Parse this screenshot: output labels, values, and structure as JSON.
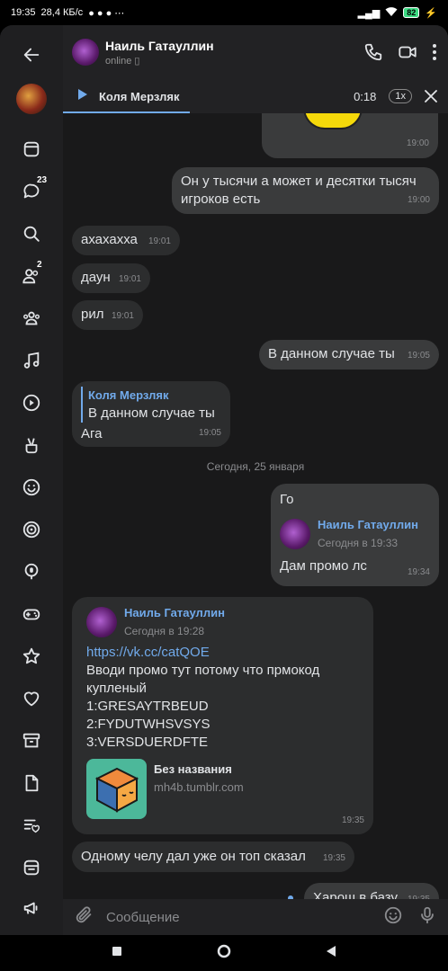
{
  "status_bar": {
    "time": "19:35",
    "speed": "28,4 КБ/с",
    "battery": "82"
  },
  "sidebar": {
    "badges": {
      "messages": "23",
      "friends": "2"
    }
  },
  "header": {
    "name": "Наиль Гатауллин",
    "status": "online"
  },
  "player": {
    "track_name": "Коля Мерзляк",
    "time": "0:18",
    "speed": "1x",
    "progress": 0.33
  },
  "messages": {
    "m1": {
      "time": "19:00"
    },
    "m2": {
      "text": "Он у тысячи а может и десятки тысяч игроков есть",
      "time": "19:00"
    },
    "m3": {
      "text": "ахахахха",
      "time": "19:01"
    },
    "m4": {
      "text": "даун",
      "time": "19:01"
    },
    "m5": {
      "text": "рил",
      "time": "19:01"
    },
    "m6": {
      "text": "В данном случае ты",
      "time": "19:05"
    },
    "m7": {
      "reply_name": "Коля Мерзляк",
      "reply_text": "В данном случае ты",
      "text": "Ага",
      "time": "19:05"
    },
    "date_separator": "Сегодня, 25 января",
    "m8": {
      "text": "Го",
      "fwd_name": "Наиль Гатауллин",
      "fwd_date": "Сегодня в 19:33",
      "fwd_text": "Дам промо лс",
      "time": "19:34"
    },
    "m9": {
      "fwd_name": "Наиль Гатауллин",
      "fwd_date": "Сегодня в 19:28",
      "link": "https://vk.cc/catQOE",
      "line1": "Вводи промо тут потому что прмокод",
      "line2": "купленый",
      "line3": "1:GRESAYTRBEUD",
      "line4": "2:FYDUTWHSVSYS",
      "line5": "3:VERSDUERDFTE",
      "snippet_title": "Без названия",
      "snippet_domain": "mh4b.tumblr.com",
      "time": "19:35"
    },
    "m10": {
      "text": "Одному челу дал уже он топ сказал",
      "time": "19:35"
    },
    "m11": {
      "text": "Харош в базу",
      "time": "19:35"
    }
  },
  "composer": {
    "placeholder": "Сообщение"
  },
  "colors": {
    "accent": "#71aaeb",
    "background": "#19191a",
    "bubble_in": "#2c2d2e",
    "bubble_out": "#3a3b3c"
  }
}
